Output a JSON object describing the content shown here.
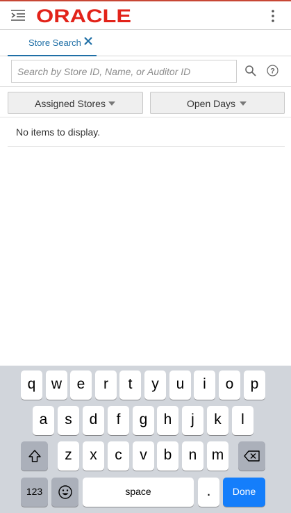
{
  "header": {
    "brand": "ORACLE",
    "brand_color": "#e2231a",
    "accent_color": "#c74634",
    "menu_icon": "navigation-menu-icon",
    "more_icon": "kebab-more-icon"
  },
  "tabs": [
    {
      "label": "Store Search",
      "active": true,
      "close_icon": "close-icon"
    }
  ],
  "search": {
    "placeholder": "Search by Store ID, Name, or Auditor ID",
    "value": "",
    "search_icon": "search-icon",
    "help_icon": "help-icon"
  },
  "filters": [
    {
      "label": "Assigned Stores",
      "icon": "caret-down-icon"
    },
    {
      "label": "Open Days",
      "icon": "caret-down-icon"
    }
  ],
  "results": {
    "empty_message": "No items to display."
  },
  "keyboard": {
    "row1": [
      "q",
      "w",
      "e",
      "r",
      "t",
      "y",
      "u",
      "i",
      "o",
      "p"
    ],
    "row2": [
      "a",
      "s",
      "d",
      "f",
      "g",
      "h",
      "j",
      "k",
      "l"
    ],
    "row3": [
      "z",
      "x",
      "c",
      "v",
      "b",
      "n",
      "m"
    ],
    "numbers_key": "123",
    "space_key": "space",
    "period_key": ".",
    "done_key": "Done",
    "shift_icon": "shift-icon",
    "backspace_icon": "backspace-icon",
    "emoji_icon": "emoji-icon",
    "done_color": "#147efb"
  }
}
